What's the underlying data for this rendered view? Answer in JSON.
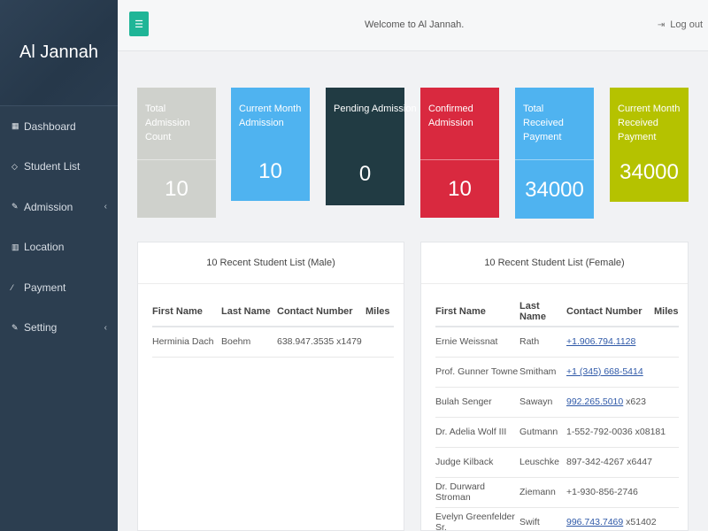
{
  "brand": "Al Jannah",
  "sidebar": {
    "items": [
      {
        "icon": "dashboard-icon",
        "glyph": "▦",
        "label": "Dashboard"
      },
      {
        "icon": "diamond-icon",
        "glyph": "◇",
        "label": "Student List"
      },
      {
        "icon": "edit-icon",
        "glyph": "✎",
        "label": "Admission",
        "caret": "‹"
      },
      {
        "icon": "bar-chart-icon",
        "glyph": "▥",
        "label": "Location"
      },
      {
        "icon": "magic-wand-icon",
        "glyph": "⁄",
        "label": "Payment"
      },
      {
        "icon": "edit-icon",
        "glyph": "✎",
        "label": "Setting",
        "caret": "‹"
      }
    ]
  },
  "topbar": {
    "menu_glyph": "☰",
    "welcome": "Welcome to Al Jannah.",
    "logout_glyph": "⇥",
    "logout": "Log out"
  },
  "stats": [
    {
      "label": "Total Admission Count",
      "value": "10",
      "color": "#cfd1cc"
    },
    {
      "label": "Current Month Admission",
      "value": "10",
      "color": "#4fb3f0"
    },
    {
      "label": "Pending Admission",
      "value": "0",
      "color": "#213b43"
    },
    {
      "label": "Confirmed Admission",
      "value": "10",
      "color": "#d9293f"
    },
    {
      "label": "Total Received Payment",
      "value": "34000",
      "color": "#4fb3f0"
    },
    {
      "label": "Current Month Received Payment",
      "value": "34000",
      "color": "#b5c200"
    }
  ],
  "male_panel": {
    "title": "10 Recent Student List (Male)",
    "headers": [
      "First Name",
      "Last Name",
      "Contact Number",
      "Miles"
    ],
    "rows": [
      {
        "first": "Herminia Dach",
        "last": "Boehm",
        "contact": "638.947.3535 x1479",
        "miles": ""
      }
    ]
  },
  "female_panel": {
    "title": "10 Recent Student List (Female)",
    "headers": [
      "First Name",
      "Last Name",
      "Contact Number",
      "Miles"
    ],
    "rows": [
      {
        "first": "Ernie Weissnat",
        "last": "Rath",
        "contact_link": "+1.906.794.1128",
        "contact_rest": ""
      },
      {
        "first": "Prof. Gunner Towne",
        "last": "Smitham",
        "contact_link": "+1 (345) 668-5414",
        "contact_rest": ""
      },
      {
        "first": "Bulah Senger",
        "last": "Sawayn",
        "contact_link": "992.265.5010",
        "contact_rest": " x623"
      },
      {
        "first": "Dr. Adelia Wolf III",
        "last": "Gutmann",
        "contact_link": "",
        "contact_rest": "1-552-792-0036 x08181"
      },
      {
        "first": "Judge Kilback",
        "last": "Leuschke",
        "contact_link": "",
        "contact_rest": "897-342-4267 x6447"
      },
      {
        "first": "Dr. Durward Stroman",
        "last": "Ziemann",
        "contact_link": "",
        "contact_rest": "+1-930-856-2746"
      },
      {
        "first": "Evelyn Greenfelder Sr.",
        "last": "Swift",
        "contact_link": "996.743.7469",
        "contact_rest": " x51402"
      }
    ]
  }
}
